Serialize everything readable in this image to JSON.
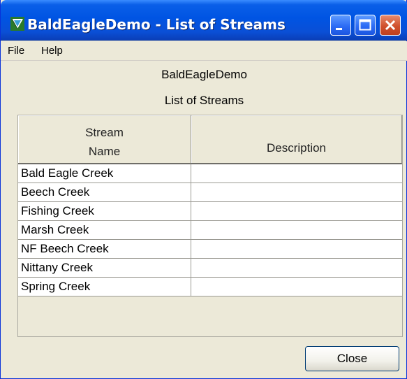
{
  "window": {
    "title": "BaldEagleDemo - List of Streams",
    "icon": "bald-eagle-app-icon",
    "controls": [
      "minimize-icon",
      "maximize-icon",
      "close-icon"
    ]
  },
  "menu": {
    "items": [
      {
        "label": "File"
      },
      {
        "label": "Help"
      }
    ]
  },
  "header": {
    "project": "BaldEagleDemo",
    "subtitle": "List of Streams"
  },
  "table": {
    "columns": [
      {
        "line1": "Stream",
        "line2": "Name"
      },
      {
        "label": "Description"
      }
    ],
    "rows": [
      {
        "name": "Bald Eagle Creek",
        "description": ""
      },
      {
        "name": "Beech Creek",
        "description": ""
      },
      {
        "name": "Fishing Creek",
        "description": ""
      },
      {
        "name": "Marsh Creek",
        "description": ""
      },
      {
        "name": "NF Beech Creek",
        "description": ""
      },
      {
        "name": "Nittany Creek",
        "description": ""
      },
      {
        "name": "Spring Creek",
        "description": ""
      }
    ]
  },
  "buttons": {
    "close_label": "Close"
  },
  "colors": {
    "titlebar": "#0054e3",
    "window_bg": "#ece9d8",
    "close_button": "#c0401f"
  }
}
